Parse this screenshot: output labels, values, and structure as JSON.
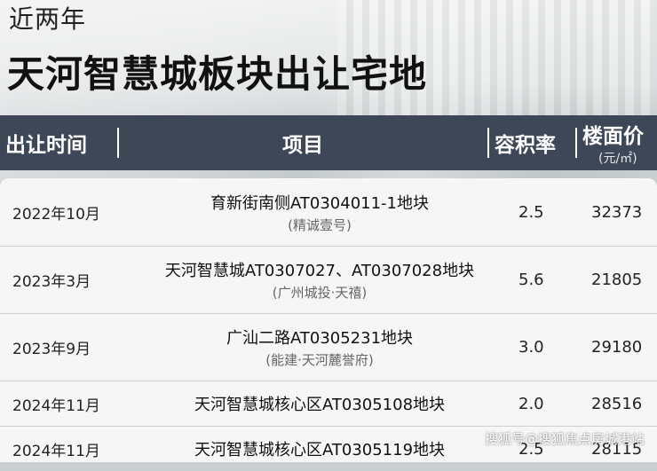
{
  "header": {
    "subtitle": "近两年",
    "title": "天河智慧城板块出让宅地"
  },
  "table": {
    "columns": {
      "time": "出让时间",
      "project": "项目",
      "far": "容积率",
      "price": "楼面价",
      "price_unit": "(元/㎡)"
    },
    "rows": [
      {
        "date": "2022年10月",
        "name": "育新街南侧AT0304011-1地块",
        "developer": "(精诚壹号)",
        "far": "2.5",
        "price": "32373"
      },
      {
        "date": "2023年3月",
        "name": "天河智慧城AT0307027、AT0307028地块",
        "developer": "(广州城投·天禧)",
        "far": "5.6",
        "price": "21805"
      },
      {
        "date": "2023年9月",
        "name": "广汕二路AT0305231地块",
        "developer": "(能建·天河麓誉府)",
        "far": "3.0",
        "price": "29180"
      },
      {
        "date": "2024年11月",
        "name": "天河智慧城核心区AT0305108地块",
        "developer": "",
        "far": "2.0",
        "price": "28516"
      },
      {
        "date": "2024年11月",
        "name": "天河智慧城核心区AT0305119地块",
        "developer": "",
        "far": "2.5",
        "price": "28115"
      }
    ]
  },
  "watermark": "搜狐号@搜狐焦点房城港站"
}
